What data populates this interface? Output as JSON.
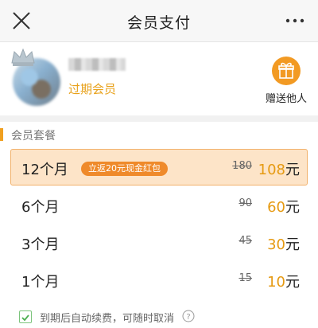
{
  "header": {
    "title": "会员支付",
    "close_icon": "close-icon",
    "more_icon": "more-icon"
  },
  "user": {
    "status": "过期会员",
    "gift_label": "赠送他人",
    "gift_icon": "gift-icon",
    "crown_icon": "crown-icon"
  },
  "packages": {
    "section_title": "会员套餐",
    "items": [
      {
        "name": "12个月",
        "badge": "立返20元现金红包",
        "original": "180",
        "price": "108",
        "unit": "元",
        "selected": true
      },
      {
        "name": "6个月",
        "badge": "",
        "original": "90",
        "price": "60",
        "unit": "元",
        "selected": false
      },
      {
        "name": "3个月",
        "badge": "",
        "original": "45",
        "price": "30",
        "unit": "元",
        "selected": false
      },
      {
        "name": "1个月",
        "badge": "",
        "original": "15",
        "price": "10",
        "unit": "元",
        "selected": false
      }
    ]
  },
  "renew": {
    "text": "到期后自动续费，可随时取消",
    "checked": true,
    "help_icon": "help-icon"
  },
  "colors": {
    "accent": "#f0a020",
    "price": "#e69a12",
    "selected_bg": "#fde4c8",
    "badge_bg": "#ef8a2b",
    "status": "#e8a11a"
  }
}
